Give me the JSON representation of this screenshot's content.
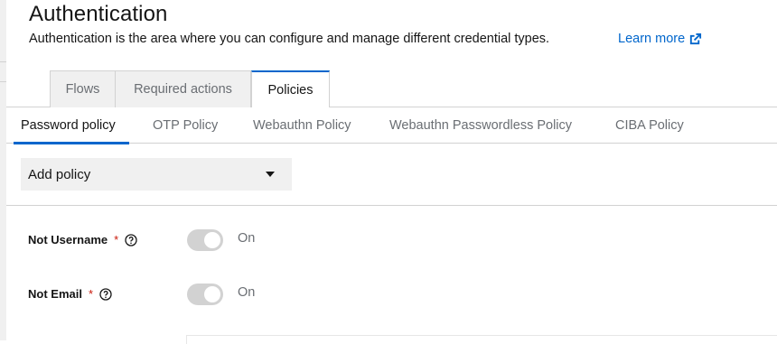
{
  "header": {
    "title": "Authentication",
    "description": "Authentication is the area where you can configure and manage different credential types.",
    "learn_more": "Learn more",
    "learn_more_icon": "external-link-icon"
  },
  "main_tabs": [
    {
      "label": "Flows",
      "active": false
    },
    {
      "label": "Required actions",
      "active": false
    },
    {
      "label": "Policies",
      "active": true
    }
  ],
  "sub_tabs": [
    {
      "label": "Password policy",
      "active": true
    },
    {
      "label": "OTP Policy",
      "active": false
    },
    {
      "label": "Webauthn Policy",
      "active": false
    },
    {
      "label": "Webauthn Passwordless Policy",
      "active": false
    },
    {
      "label": "CIBA Policy",
      "active": false
    }
  ],
  "add_policy": {
    "label": "Add policy",
    "icon": "caret-down-icon"
  },
  "policies": [
    {
      "label": "Not Username",
      "required_marker": "*",
      "help_icon": "help-icon",
      "state": "On"
    },
    {
      "label": "Not Email",
      "required_marker": "*",
      "help_icon": "help-icon",
      "state": "On"
    }
  ],
  "colors": {
    "accent": "#0066cc",
    "required": "#c9190b",
    "toggle_off_track": "#d2d2d2"
  }
}
